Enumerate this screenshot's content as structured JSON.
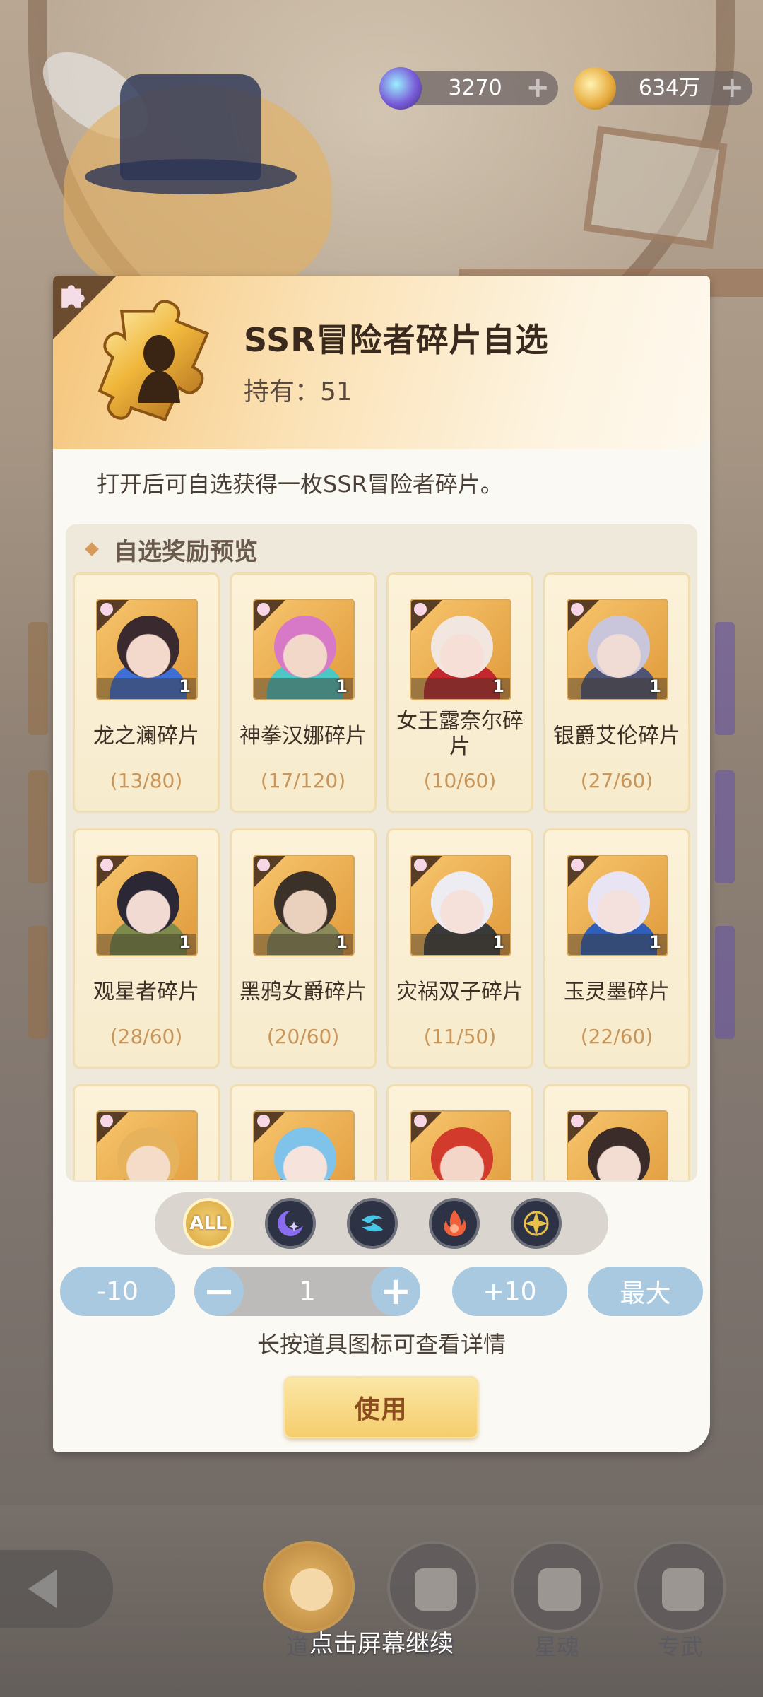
{
  "currencies": [
    {
      "name": "gem",
      "icon": "gem-icon",
      "value": "3270"
    },
    {
      "name": "gold",
      "icon": "gold-coin-icon",
      "value": "634万"
    }
  ],
  "dialog": {
    "title": "SSR冒险者碎片自选",
    "owned": "持有：51",
    "description": "打开后可自选获得一枚SSR冒险者碎片。",
    "preview_title": "自选奖励预览",
    "items": [
      {
        "name": "龙之澜碎片",
        "progress": "(13/80)",
        "count": "1",
        "hair": "#3a2a30",
        "skin": "#f3d9cc",
        "accent": "#3d6fd6"
      },
      {
        "name": "神拳汉娜碎片",
        "progress": "(17/120)",
        "count": "1",
        "hair": "#d879c8",
        "skin": "#f2d8c8",
        "accent": "#4cc7c4"
      },
      {
        "name": "女王露奈尔碎片",
        "progress": "(10/60)",
        "count": "1",
        "hair": "#f1e6e0",
        "skin": "#f6dfd6",
        "accent": "#c2272d"
      },
      {
        "name": "银爵艾伦碎片",
        "progress": "(27/60)",
        "count": "1",
        "hair": "#c9c6dc",
        "skin": "#f0dcd4",
        "accent": "#4f5472"
      },
      {
        "name": "观星者碎片",
        "progress": "(28/60)",
        "count": "1",
        "hair": "#2b2734",
        "skin": "#f1dad2",
        "accent": "#7d8a4a"
      },
      {
        "name": "黑鸦女爵碎片",
        "progress": "(20/60)",
        "count": "1",
        "hair": "#3b3128",
        "skin": "#e9d1bd",
        "accent": "#8a8a5a"
      },
      {
        "name": "灾祸双子碎片",
        "progress": "(11/50)",
        "count": "1",
        "hair": "#ececf2",
        "skin": "#f5e0da",
        "accent": "#3a3a3a"
      },
      {
        "name": "玉灵墨碎片",
        "progress": "(22/60)",
        "count": "1",
        "hair": "#e8e4f3",
        "skin": "#f4e0dc",
        "accent": "#2f5fb8"
      },
      {
        "name": "",
        "progress": "",
        "count": "",
        "hair": "#e6b35c",
        "skin": "#f4dcc8",
        "accent": "#c48a3a"
      },
      {
        "name": "",
        "progress": "",
        "count": "",
        "hair": "#7fc3ea",
        "skin": "#f6e3dc",
        "accent": "#2e4a8a"
      },
      {
        "name": "",
        "progress": "",
        "count": "",
        "hair": "#d23a2c",
        "skin": "#f4d6c8",
        "accent": "#f2f2f2"
      },
      {
        "name": "",
        "progress": "",
        "count": "",
        "hair": "#3b2c2a",
        "skin": "#f3dcd2",
        "accent": "#b5b0b6"
      }
    ],
    "filters": [
      {
        "label": "ALL",
        "icon": "all-filter-icon",
        "selected": true
      },
      {
        "label": "",
        "icon": "moon-element-icon",
        "color": "#8a6cf0",
        "selected": false
      },
      {
        "label": "",
        "icon": "wind-element-icon",
        "color": "#47c6e8",
        "selected": false
      },
      {
        "label": "",
        "icon": "fire-element-icon",
        "color": "#f0603a",
        "selected": false
      },
      {
        "label": "",
        "icon": "star-element-icon",
        "color": "#e8c04a",
        "selected": false
      }
    ],
    "quantity": {
      "minus10": "-10",
      "minus": "−",
      "value": "1",
      "plus": "+",
      "plus10": "+10",
      "max": "最大"
    },
    "hint": "长按道具图标可查看详情",
    "use_button": "使用"
  },
  "bottom_nav": [
    {
      "label": "道具",
      "active": true
    },
    {
      "label": "特效",
      "active": false
    },
    {
      "label": "星魂",
      "active": false
    },
    {
      "label": "专武",
      "active": false
    }
  ],
  "tap_to_continue": "点击屏幕继续",
  "colors": {
    "accent_gold": "#f5cd6c",
    "progress_text": "#c8955a",
    "stepper_blue": "#a8c9e0",
    "dialog_bg": "#fbf9f3"
  }
}
